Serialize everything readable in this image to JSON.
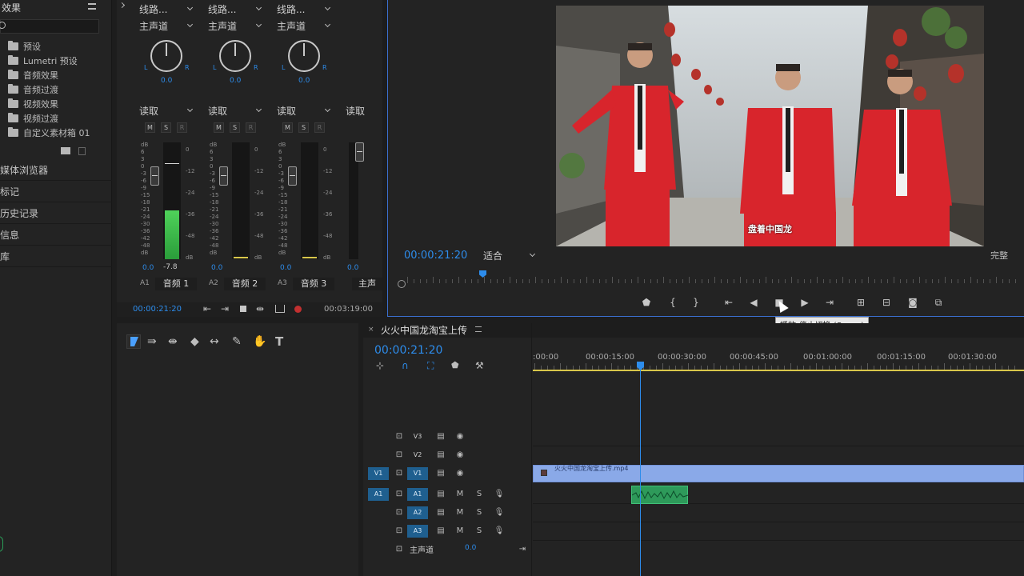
{
  "effects_panel": {
    "title": "效果",
    "search_value": "",
    "items": [
      {
        "icon": "folder-icon",
        "label": "预设"
      },
      {
        "icon": "folder-icon",
        "label": "Lumetri 预设"
      },
      {
        "icon": "folder-icon",
        "label": "音频效果"
      },
      {
        "icon": "folder-icon",
        "label": "音频过渡"
      },
      {
        "icon": "folder-icon",
        "label": "视频效果"
      },
      {
        "icon": "folder-icon",
        "label": "视频过渡"
      },
      {
        "icon": "folder-icon",
        "label": "自定义素材箱 01"
      }
    ],
    "side_links": [
      "媒体浏览器",
      "标记",
      "历史记录",
      "信息",
      "库"
    ]
  },
  "mixer": {
    "channels": [
      {
        "route": "线路...",
        "output": "主声道",
        "pan": "0.0",
        "mode": "读取",
        "value": "0.0",
        "peak": "-7.8",
        "track": "A1",
        "name": "音频 1",
        "level": 0.72
      },
      {
        "route": "线路...",
        "output": "主声道",
        "pan": "0.0",
        "mode": "读取",
        "value": "0.0",
        "peak": "",
        "track": "A2",
        "name": "音频 2",
        "level": 0.0
      },
      {
        "route": "线路...",
        "output": "主声道",
        "pan": "0.0",
        "mode": "读取",
        "value": "0.0",
        "peak": "",
        "track": "A3",
        "name": "音频 3",
        "level": 0.0
      }
    ],
    "master": {
      "mode": "读取",
      "value": "0.0",
      "name": "主声"
    },
    "scale": [
      "dB",
      "6",
      "3",
      "0",
      "-3",
      "-6",
      "-9",
      "-15",
      "-18",
      "-21",
      "-24",
      "-30",
      "-36",
      "-42",
      "-48",
      "dB"
    ],
    "peak_scale": [
      "0",
      "-12",
      "-24",
      "-36",
      "-48",
      "dB"
    ],
    "solo_labels": {
      "m": "M",
      "s": "S",
      "r": "R"
    },
    "timecode_current": "00:00:21:20",
    "timecode_duration": "00:03:19:00"
  },
  "program": {
    "timecode": "00:00:21:20",
    "fit": "适合",
    "quality": "完整",
    "subtitle": "盘着中国龙",
    "tooltip": "播放-停止切换 (Space)",
    "playhead_fraction": 0.13,
    "colors": {
      "accent": "#2d8ceb",
      "suit": "#d8252c"
    }
  },
  "sequence": {
    "name": "火火中国龙淘宝上传",
    "timecode": "00:00:21:20",
    "ruler": [
      ":00:00",
      "00:00:15:00",
      "00:00:30:00",
      "00:00:45:00",
      "00:01:00:00",
      "00:01:15:00",
      "00:01:30:00"
    ],
    "tracks": [
      {
        "label": "V3",
        "target": "",
        "type": "video"
      },
      {
        "label": "V2",
        "target": "",
        "type": "video"
      },
      {
        "label": "V1",
        "target": "V1",
        "type": "video",
        "on": true
      },
      {
        "label": "A1",
        "target": "A1",
        "type": "audio",
        "on": true
      },
      {
        "label": "A2",
        "target": "",
        "type": "audio",
        "on": true
      },
      {
        "label": "A3",
        "target": "",
        "type": "audio",
        "on": true
      }
    ],
    "master_label": "主声道",
    "master_value": "0.0",
    "clip_name": "火火中国龙淘宝上传.mp4",
    "audio_clip": ""
  }
}
